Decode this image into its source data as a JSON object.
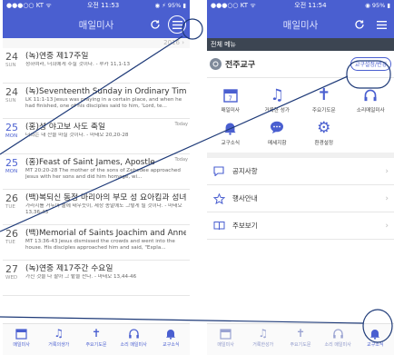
{
  "left": {
    "status": {
      "left": "●●●○○ KT ᯤ",
      "time": "오전 11:53",
      "right": "◉ ⚡ 95% ▮"
    },
    "nav_title": "매일미사",
    "year": "2016 ›",
    "entries": [
      {
        "num": "24",
        "day": "SUN",
        "title": "(녹)연중 제17주일",
        "desc": "청하여라, 너희에게 주실 것이다. - 루카 11,1-13",
        "today": false
      },
      {
        "num": "24",
        "day": "SUN",
        "title": "(녹)Seventeenth Sunday in Ordinary Time",
        "desc": "LK 11:1-13  Jesus was praying in a certain place, and when he had finished, one of his disciples said to him, 'Lord, te...",
        "today": false
      },
      {
        "num": "25",
        "day": "MON",
        "title": "(홍)성 야고보 사도 축일",
        "desc": "너희는 내 잔을 마실 것이다. - 마태오 20,20-28",
        "today": true,
        "badge": "Today"
      },
      {
        "num": "25",
        "day": "MON",
        "title": "(홍)Feast of Saint James, Apostle",
        "desc": "MT 20:20-28  The mother of the sons of Zebedee approached Jesus with her sons and did him homage, wi...",
        "today": true,
        "badge": "Today"
      },
      {
        "num": "26",
        "day": "TUE",
        "title": "(백)복되신 동정 마리아의 부모 성 요아킴과 성녀 안...",
        "desc": "가라지를 거두어 불에 태우듯이, 세상 종말에도 그렇게 될 것이다. - 마태오 13,36-43",
        "today": false
      },
      {
        "num": "26",
        "day": "TUE",
        "title": "(백)Memorial of Saints Joachim and Anne, Pa...",
        "desc": "MT 13:36-43  Jesus dismissed the crowds and went into the house. His disciples approached him and said, \"Expla...",
        "today": false
      },
      {
        "num": "27",
        "day": "WED",
        "title": "(녹)연중 제17주간 수요일",
        "desc": "가진 것을 다 팔아 그 밭을 산다. - 마태오 13,44-46",
        "today": false
      }
    ],
    "tabs": [
      "매일미사",
      "거룩의생가",
      "주요기도문",
      "소리 매일미사",
      "교구소식"
    ]
  },
  "right": {
    "status": {
      "left": "●●●○○ KT ᯤ",
      "time": "오전 11:54",
      "right": "◉ 95% ▮"
    },
    "nav_title": "매일미사",
    "section": "전체 메뉴",
    "parish": "전주교구",
    "parish_setting": "교구설정/변경",
    "grid": [
      "매일미사",
      "거룩한 성가",
      "주요기도문",
      "소리매일미사",
      "교구소식",
      "메세지함",
      "환경설정"
    ],
    "list": [
      "공지사항",
      "행사안내",
      "주보보기"
    ],
    "tabs": [
      "매일미사",
      "거룩한성가",
      "주요기도문",
      "소리 매일미사",
      "교구소식"
    ]
  },
  "colors": {
    "accent": "#4a5fd0",
    "annotation": "#1e3a78"
  }
}
